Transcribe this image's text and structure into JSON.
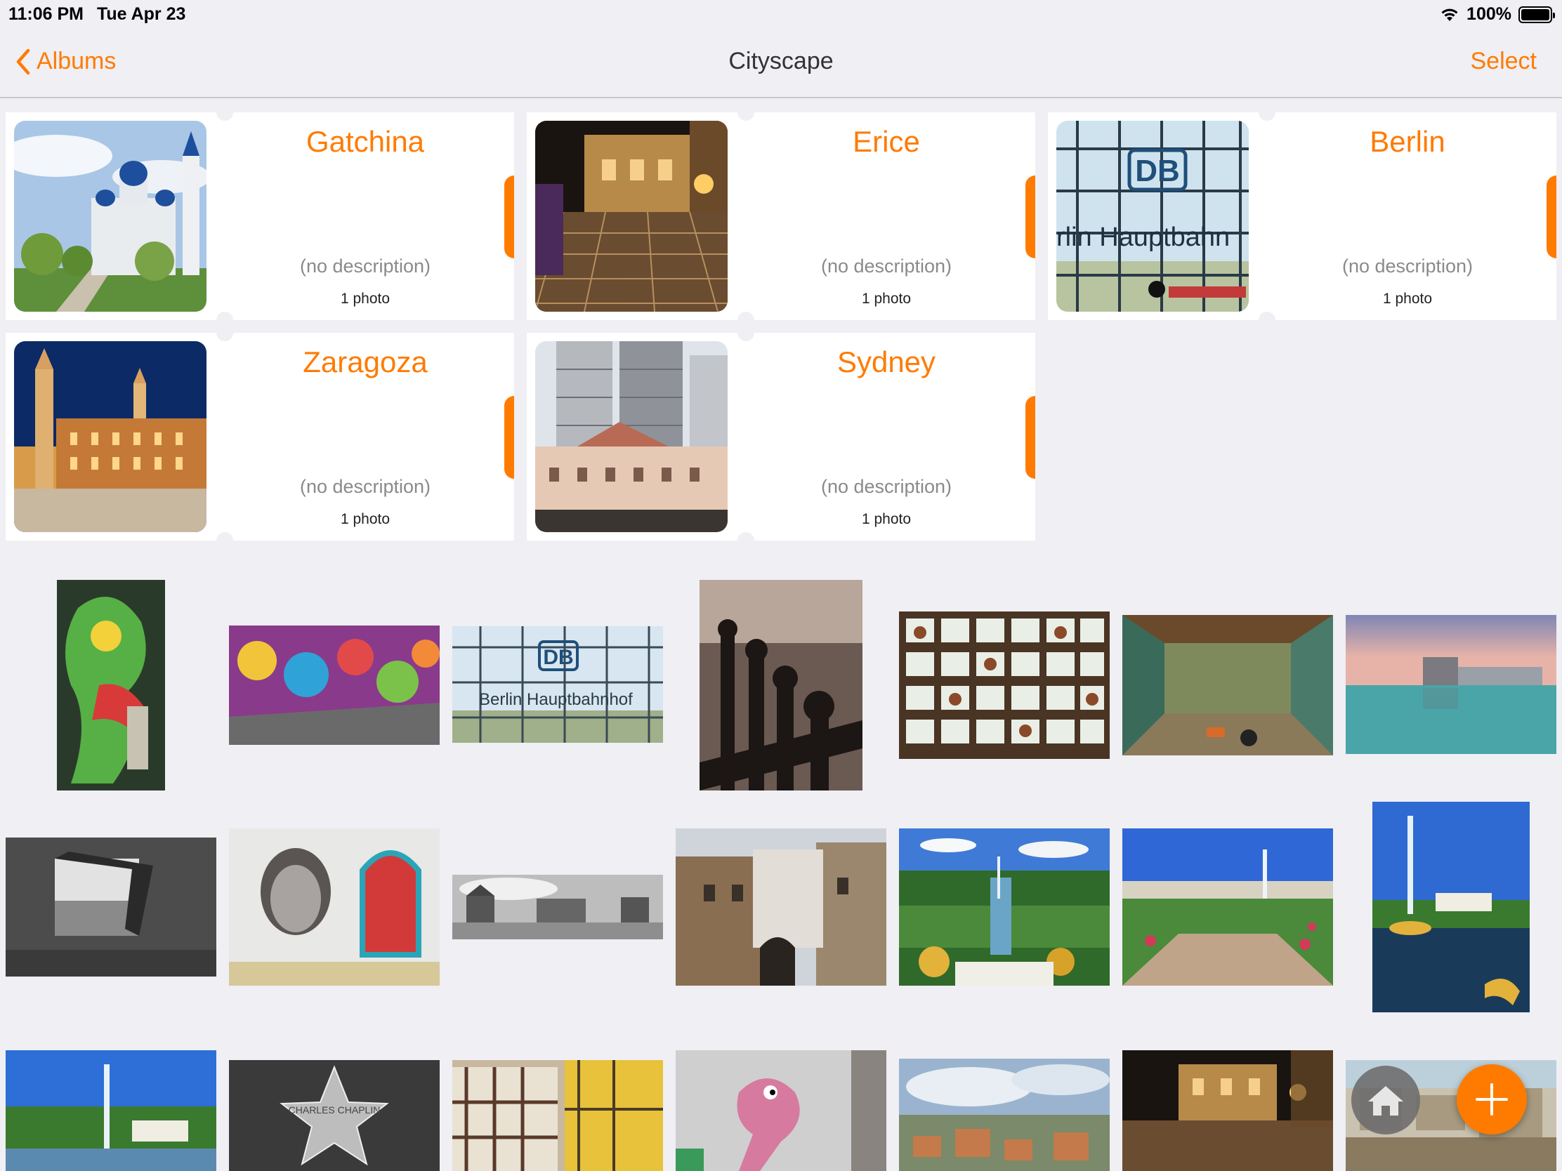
{
  "status": {
    "time": "11:06 PM",
    "date": "Tue Apr 23",
    "battery": "100%"
  },
  "nav": {
    "back_label": "Albums",
    "title": "Cityscape",
    "select_label": "Select"
  },
  "albums": [
    {
      "title": "Gatchina",
      "description": "(no description)",
      "count": "1 photo"
    },
    {
      "title": "Erice",
      "description": "(no description)",
      "count": "1 photo"
    },
    {
      "title": "Berlin",
      "description": "(no description)",
      "count": "1 photo"
    },
    {
      "title": "Zaragoza",
      "description": "(no description)",
      "count": "1 photo"
    },
    {
      "title": "Sydney",
      "description": "(no description)",
      "count": "1 photo"
    }
  ],
  "thumb_labels": {
    "berlin_album": "rlin Hauptbahn",
    "db_logo": "DB",
    "berlin_photo": "Berlin Hauptbahnhof",
    "chaplin": "CHARLES  CHAPLIN"
  },
  "icons": {
    "back": "chevron-left-icon",
    "wifi": "wifi-icon",
    "battery": "battery-icon",
    "home": "home-icon",
    "add": "plus-icon"
  },
  "colors": {
    "accent": "#ff7b00",
    "background": "#efeff4"
  }
}
